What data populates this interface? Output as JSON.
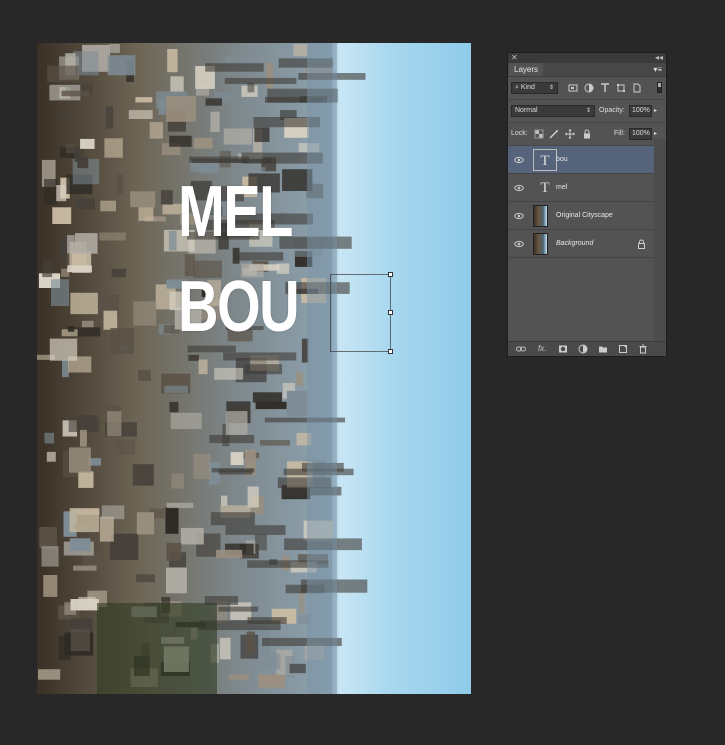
{
  "canvas": {
    "text_line_1": "MEL",
    "text_line_2": "BOU"
  },
  "layers_panel": {
    "tab_label": "Layers",
    "filter": {
      "kind_label": "Kind"
    },
    "blend_mode": "Normal",
    "opacity_label": "Opacity:",
    "opacity_value": "100%",
    "lock_label": "Lock:",
    "fill_label": "Fill:",
    "fill_value": "100%",
    "layers": [
      {
        "name": "bou",
        "type": "text",
        "selected": true
      },
      {
        "name": "mel",
        "type": "text",
        "selected": false
      },
      {
        "name": "Original Cityscape",
        "type": "image",
        "selected": false
      },
      {
        "name": "Background",
        "type": "image",
        "selected": false,
        "locked": true
      }
    ]
  },
  "colors": {
    "workspace": "#282828",
    "panel": "#535353",
    "selected_layer": "#56647b",
    "sky": "#bfe3f5"
  }
}
